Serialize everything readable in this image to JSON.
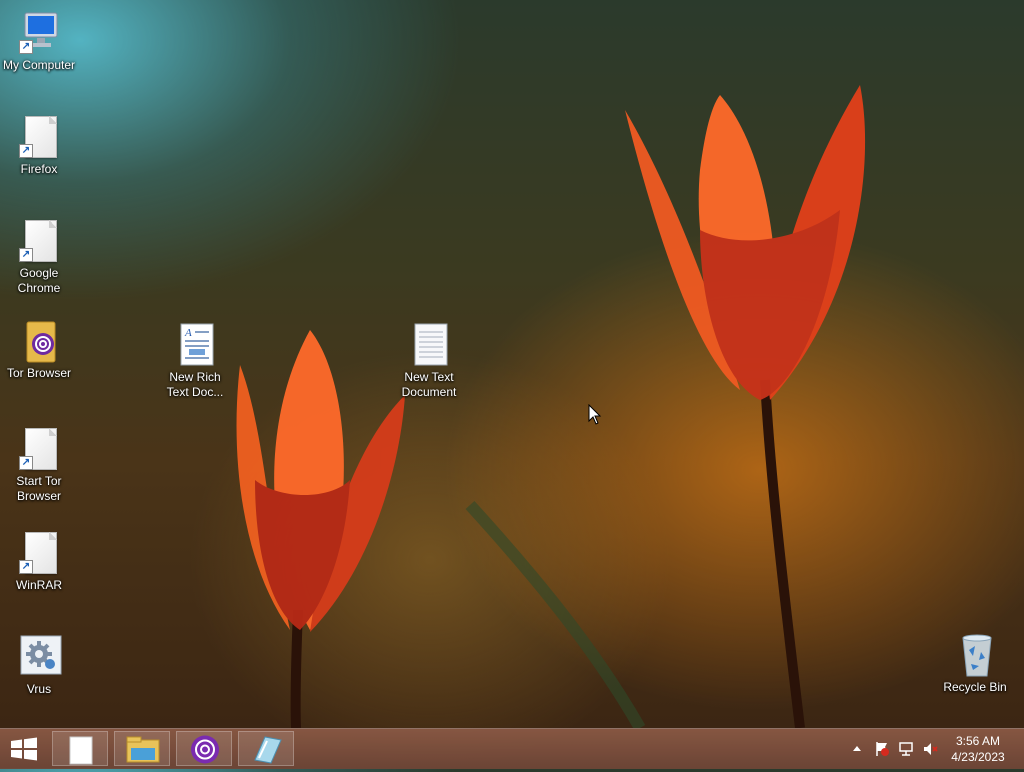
{
  "desktop_icons": [
    {
      "id": "my-computer",
      "label": "My Computer",
      "icon": "computer-icon"
    },
    {
      "id": "firefox",
      "label": "Firefox",
      "icon": "file-shortcut-icon"
    },
    {
      "id": "google-chrome",
      "label": "Google Chrome",
      "icon": "file-shortcut-icon"
    },
    {
      "id": "tor-browser",
      "label": "Tor Browser",
      "icon": "tor-folder-icon"
    },
    {
      "id": "start-tor-browser",
      "label": "Start Tor Browser",
      "icon": "file-shortcut-icon"
    },
    {
      "id": "winrar",
      "label": "WinRAR",
      "icon": "file-shortcut-icon"
    },
    {
      "id": "vrus",
      "label": "Vrus",
      "icon": "settings-app-icon"
    },
    {
      "id": "new-rich-text",
      "label": "New Rich Text Doc...",
      "icon": "rich-text-document-icon"
    },
    {
      "id": "new-text-document",
      "label": "New Text Document",
      "icon": "text-document-icon"
    },
    {
      "id": "recycle-bin",
      "label": "Recycle Bin",
      "icon": "recycle-bin-icon"
    }
  ],
  "taskbar": {
    "start_icon": "windows-logo-icon",
    "pinned": [
      "blank-document-icon",
      "file-explorer-icon",
      "tor-browser-icon",
      "notepad-app-icon"
    ],
    "tray": {
      "show_hidden_icon": "chevron-up-icon",
      "icons": [
        "action-center-flag-icon",
        "network-icon",
        "speaker-muted-icon"
      ]
    },
    "clock": {
      "time": "3:56 AM",
      "date": "4/23/2023"
    }
  },
  "colors": {
    "taskbar": "#7a4e3e",
    "tulip": "#e6451c",
    "label_text": "#ffffff"
  }
}
